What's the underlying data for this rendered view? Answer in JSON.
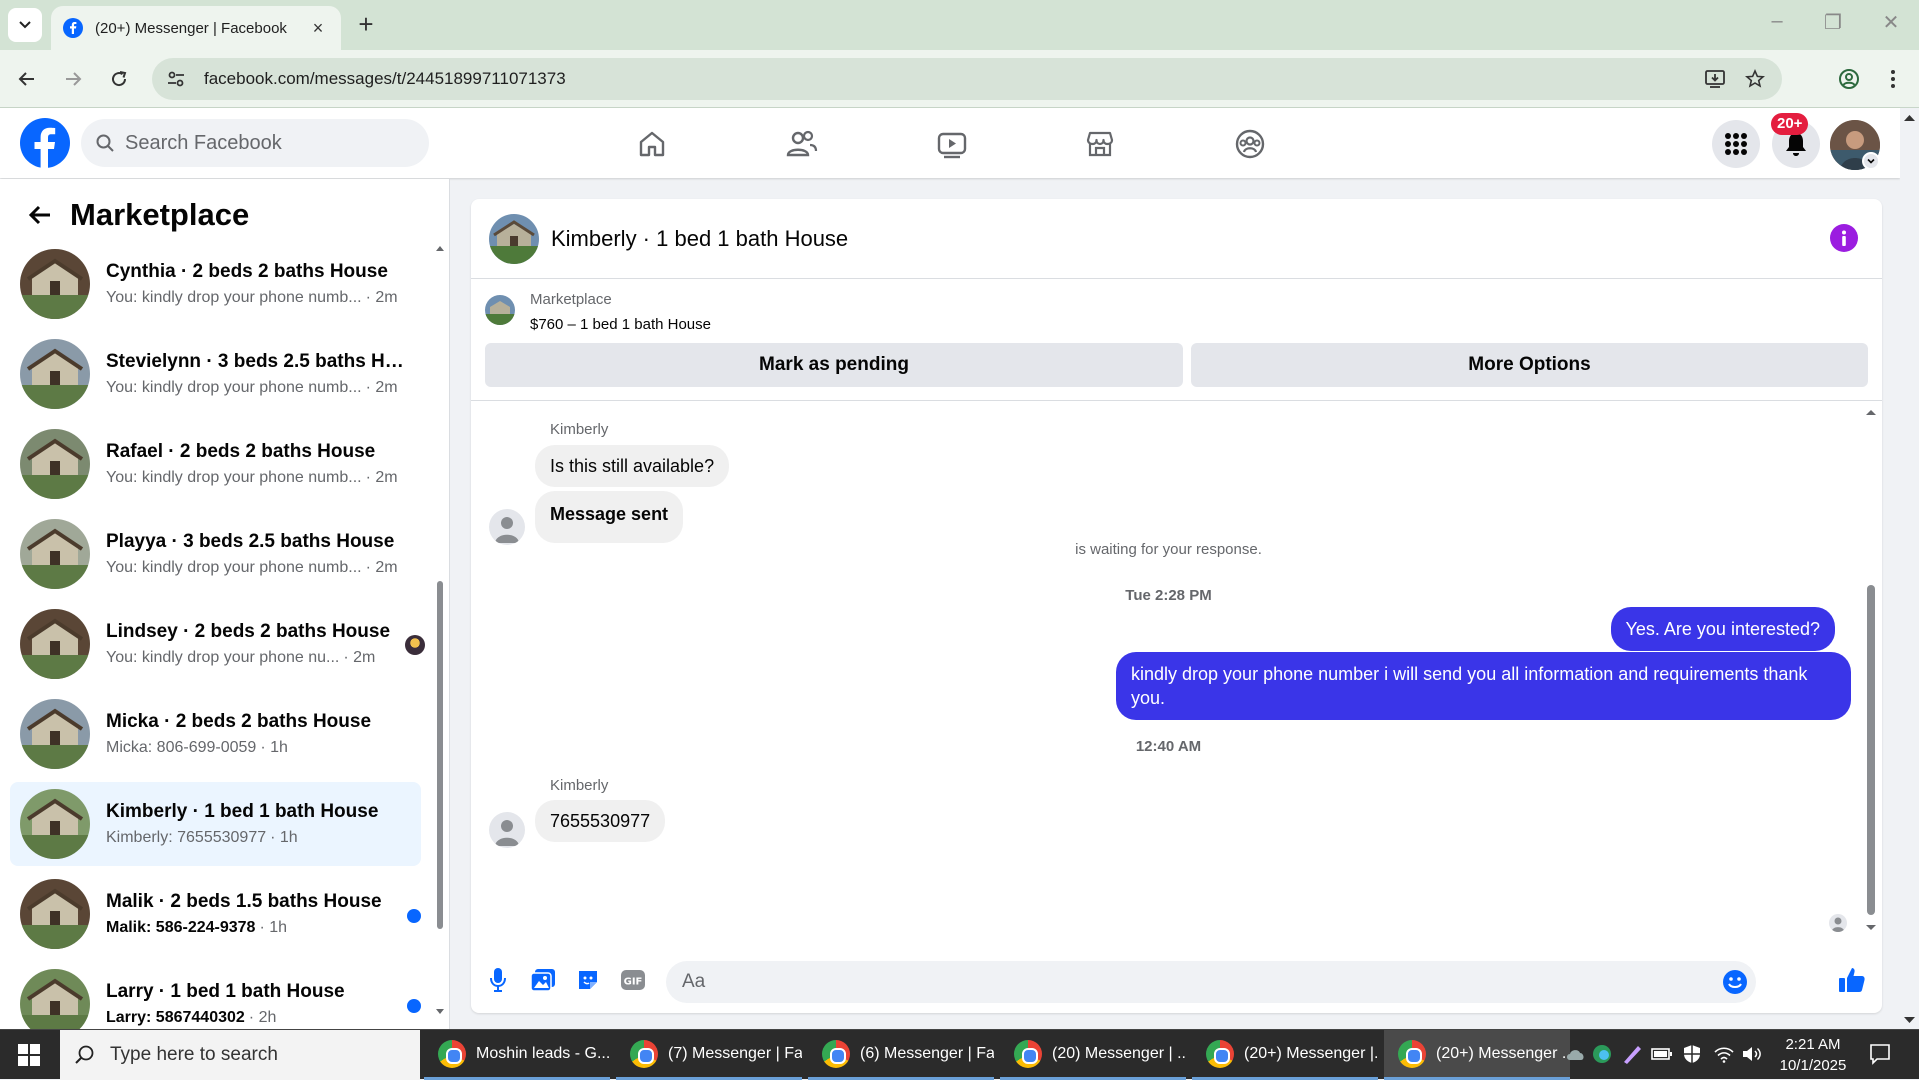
{
  "browser": {
    "tab_title": "(20+) Messenger | Facebook",
    "url": "facebook.com/messages/t/24451899711071373"
  },
  "fb": {
    "search_placeholder": "Search Facebook",
    "notification_badge": "20+"
  },
  "sidebar": {
    "title": "Marketplace",
    "conversations": [
      {
        "name": "Cynthia · 2 beds 2 baths House",
        "preview": "You: kindly drop your phone numb...",
        "time": "2m",
        "unread": false
      },
      {
        "name": "Stevielynn · 3 beds 2.5 baths Ho...",
        "preview": "You: kindly drop your phone numb...",
        "time": "2m",
        "unread": false
      },
      {
        "name": "Rafael · 2 beds 2 baths House",
        "preview": "You: kindly drop your phone numb...",
        "time": "2m",
        "unread": false
      },
      {
        "name": "Playya · 3 beds 2.5 baths House",
        "preview": "You: kindly drop your phone numb...",
        "time": "2m",
        "unread": false
      },
      {
        "name": "Lindsey · 2 beds 2 baths House",
        "preview": "You: kindly drop your phone nu...",
        "time": "2m",
        "unread": false
      },
      {
        "name": "Micka · 2 beds 2 baths House",
        "preview": "Micka: 806-699-0059",
        "time": "1h",
        "unread": false
      },
      {
        "name": "Kimberly · 1 bed 1 bath House",
        "preview": "Kimberly: 7655530977",
        "time": "1h",
        "unread": false
      },
      {
        "name": "Malik · 2 beds 1.5 baths House",
        "preview": "Malik: 586-224-9378",
        "time": "1h",
        "unread": true
      },
      {
        "name": "Larry · 1 bed 1 bath House",
        "preview": "Larry: 5867440302",
        "time": "2h",
        "unread": true
      }
    ]
  },
  "chat": {
    "title": "Kimberly · 1 bed 1 bath House",
    "listing_source": "Marketplace",
    "listing_price": "$760 – 1 bed 1 bath House",
    "mark_pending_label": "Mark as pending",
    "more_options_label": "More Options",
    "sender_name": "Kimberly",
    "msg1": "Is this still available?",
    "msg2": "Message sent",
    "waiting_text": "is waiting for your response.",
    "time1": "Tue 2:28 PM",
    "out1": "Yes. Are you interested?",
    "out2": "kindly drop your phone number i will send you all information and requirements thank you.",
    "time2": "12:40 AM",
    "sender_name2": "Kimberly",
    "msg3": "7655530977",
    "composer_placeholder": "Aa"
  },
  "taskbar": {
    "search_placeholder": "Type here to search",
    "tasks": [
      "Moshin leads - G...",
      "(7) Messenger | Fa...",
      "(6) Messenger | Fa...",
      "(20) Messenger | ...",
      "(20+) Messenger |...",
      "(20+) Messenger ..."
    ],
    "time": "2:21 AM",
    "date": "10/1/2025"
  },
  "colors": {
    "fb_blue": "#0866ff",
    "outgoing_bubble": "#3a35e8",
    "badge_red": "#e41e3f",
    "active_conv": "#ebf5ff"
  }
}
